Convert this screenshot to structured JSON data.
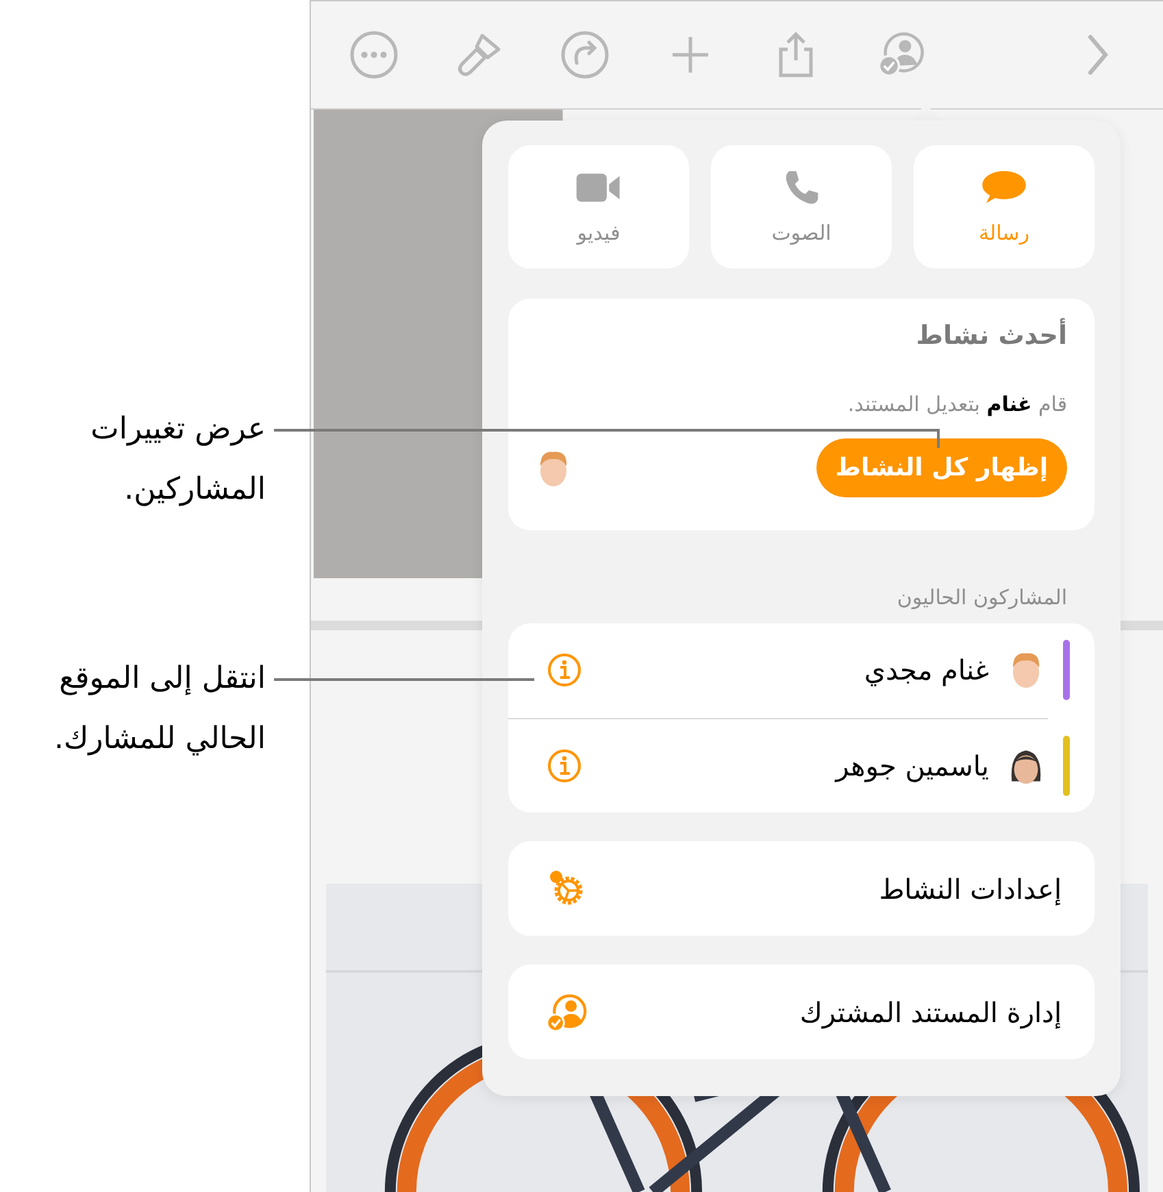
{
  "contact_buttons": [
    {
      "kind": "message",
      "label": "رسالة",
      "selected": true
    },
    {
      "kind": "audio",
      "label": "الصوت",
      "selected": false
    },
    {
      "kind": "video",
      "label": "فيديو",
      "selected": false
    }
  ],
  "recent_activity": {
    "title": "أحدث نشاط",
    "text": "قام **غنام** بتعديل المستند.",
    "button": "إظهار كل النشاط"
  },
  "participants": {
    "heading": "المشاركون الحاليون",
    "items": [
      {
        "name": "غنام مجدي",
        "color": "#a772e8"
      },
      {
        "name": "ياسمين جوهر",
        "color": "#e2c020"
      }
    ]
  },
  "actions": [
    {
      "kind": "settings",
      "label": "إعدادات النشاط"
    },
    {
      "kind": "manage",
      "label": "إدارة المستند المشترك"
    }
  ],
  "callouts": [
    {
      "text": "عرض تغييرات المشاركين."
    },
    {
      "text": "انتقل إلى الموقع الحالي للمشارك."
    }
  ]
}
